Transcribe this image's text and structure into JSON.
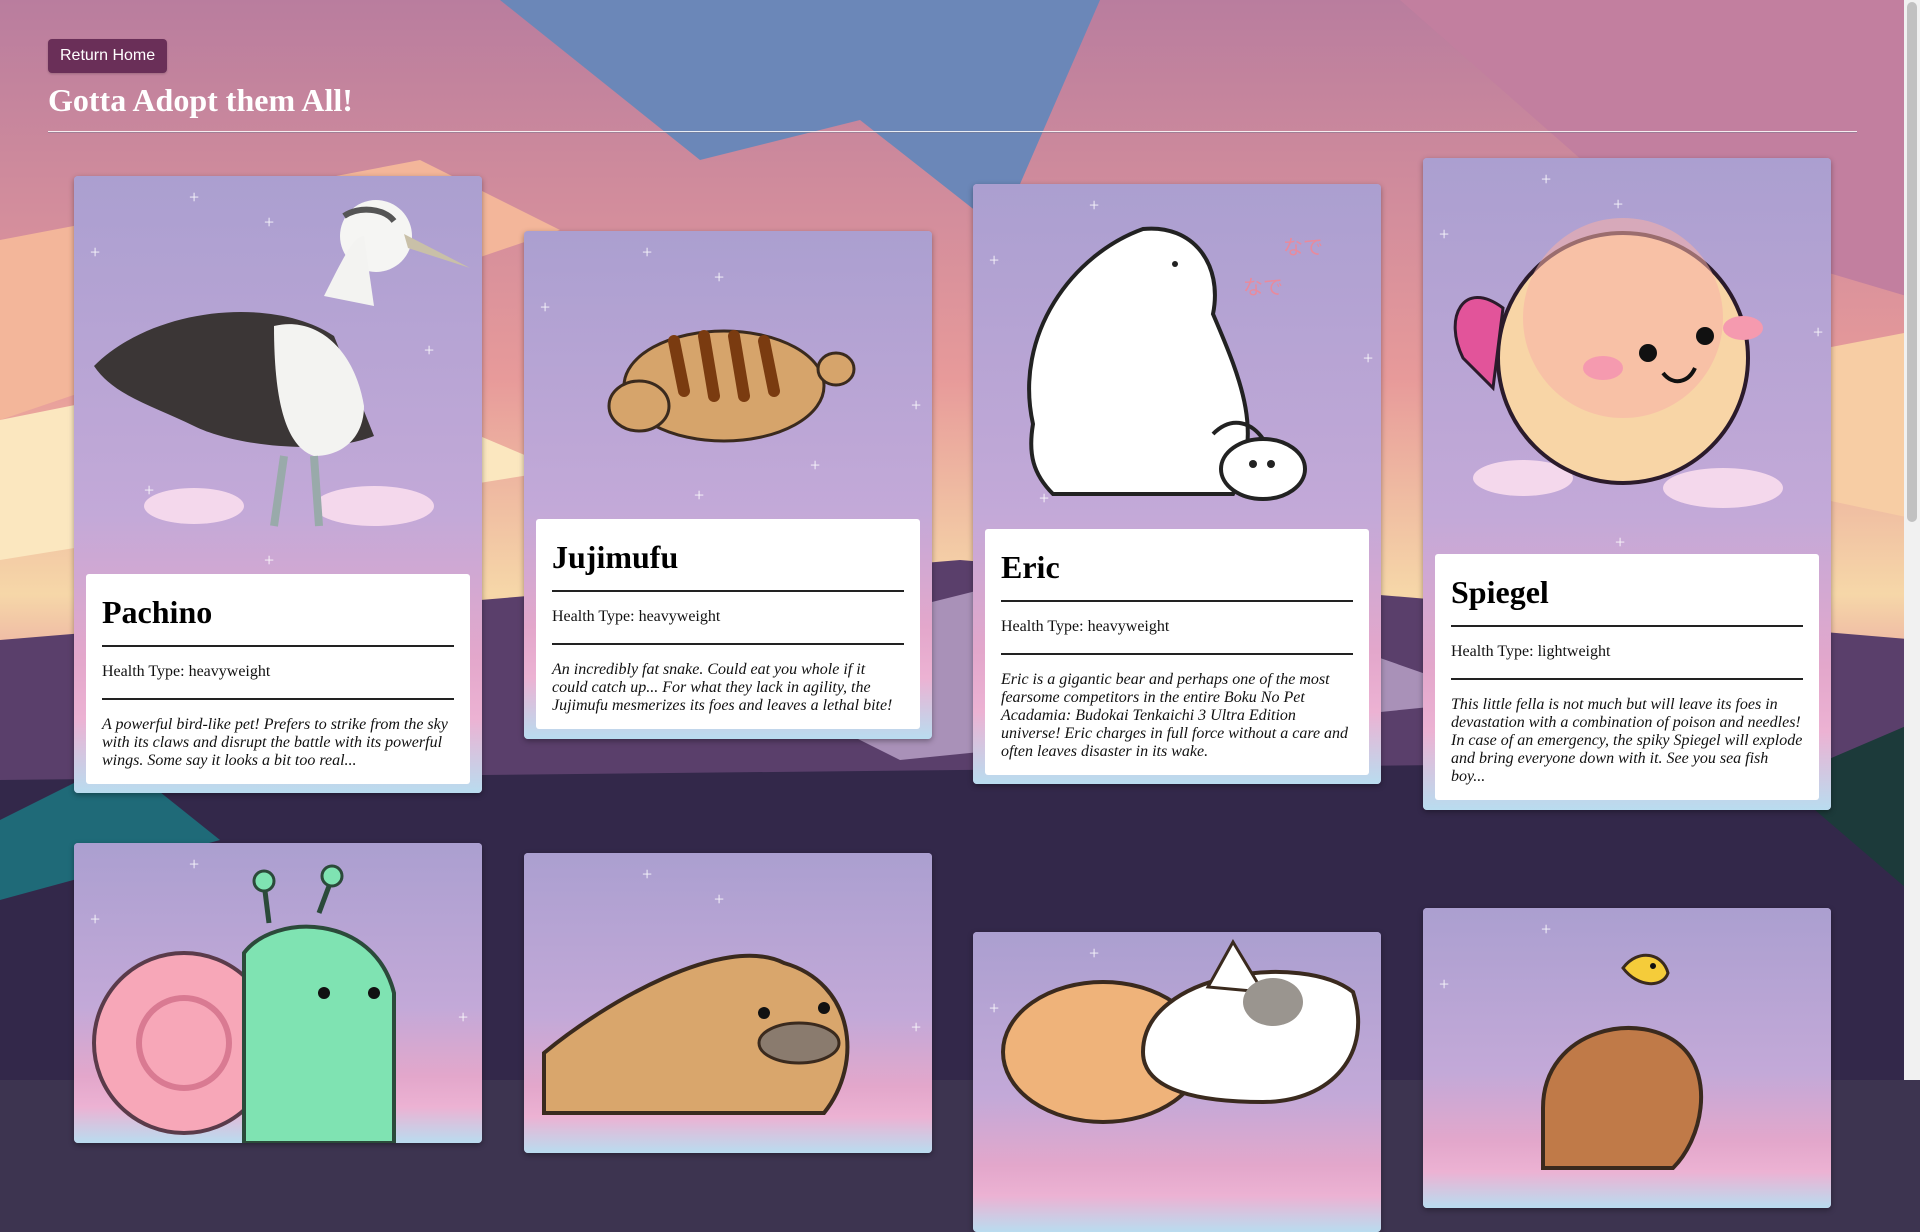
{
  "nav": {
    "return_label": "Return Home"
  },
  "page": {
    "title": "Gotta Adopt them All!"
  },
  "cards": [
    {
      "name": "Pachino",
      "health": "Health Type: heavyweight",
      "description": "A powerful bird-like pet! Prefers to strike from the sky with its claws and disrupt the battle with its powerful wings. Some say it looks a bit too real...",
      "image_icon": "albatross-icon"
    },
    {
      "name": "Jujimufu",
      "health": "Health Type: heavyweight",
      "description": "An incredibly fat snake. Could eat you whole if it could catch up... For what they lack in agility, the Jujimufu mesmerizes its foes and leaves a lethal bite!",
      "image_icon": "fat-snake-icon"
    },
    {
      "name": "Eric",
      "health": "Health Type: heavyweight",
      "description": "Eric is a gigantic bear and perhaps one of the most fearsome competitors in the entire Boku No Pet Acadamia: Budokai Tenkaichi 3 Ultra Edition universe! Eric charges in full force without a care and often leaves disaster in its wake.",
      "image_icon": "polar-bear-icon"
    },
    {
      "name": "Spiegel",
      "health": "Health Type: lightweight",
      "description": "This little fella is not much but will leave its foes in devastation with a combination of poison and needles! In case of an emergency, the spiky Spiegel will explode and bring everyone down with it. See you sea fish boy...",
      "image_icon": "pufferfish-icon"
    },
    {
      "image_icon": "snail-icon"
    },
    {
      "image_icon": "platypus-icon"
    },
    {
      "image_icon": "calico-cat-icon"
    },
    {
      "image_icon": "capybara-icon"
    }
  ],
  "colors": {
    "button_bg": "#6a2f58",
    "card_bg": "#b7a6d4",
    "title_text": "#ffffff"
  }
}
